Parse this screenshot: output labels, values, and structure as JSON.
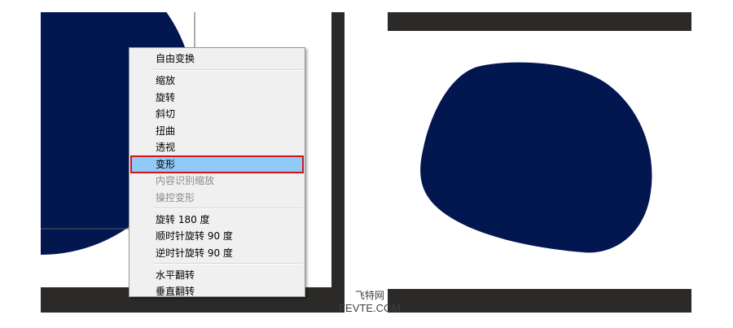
{
  "colors": {
    "shape_fill": "#021650",
    "panel_dark": "#2b2a29",
    "menu_bg": "#f0f0f0",
    "menu_highlight": "#91c9f7",
    "highlight_border": "#d0141b",
    "disabled_text": "#8d8d8d"
  },
  "context_menu": {
    "groups": [
      [
        {
          "label": "自由变换",
          "enabled": true
        }
      ],
      [
        {
          "label": "缩放",
          "enabled": true
        },
        {
          "label": "旋转",
          "enabled": true
        },
        {
          "label": "斜切",
          "enabled": true
        },
        {
          "label": "扭曲",
          "enabled": true
        },
        {
          "label": "透视",
          "enabled": true
        },
        {
          "label": "变形",
          "enabled": true,
          "highlighted": true
        },
        {
          "label": "内容识别缩放",
          "enabled": false
        },
        {
          "label": "操控变形",
          "enabled": false
        }
      ],
      [
        {
          "label": "旋转 180 度",
          "enabled": true
        },
        {
          "label": "顺时针旋转 90 度",
          "enabled": true
        },
        {
          "label": "逆时针旋转 90 度",
          "enabled": true
        }
      ],
      [
        {
          "label": "水平翻转",
          "enabled": true
        },
        {
          "label": "垂直翻转",
          "enabled": true
        }
      ]
    ]
  },
  "watermark": {
    "line1": "飞特网",
    "line2": "FEVTE.COM"
  }
}
